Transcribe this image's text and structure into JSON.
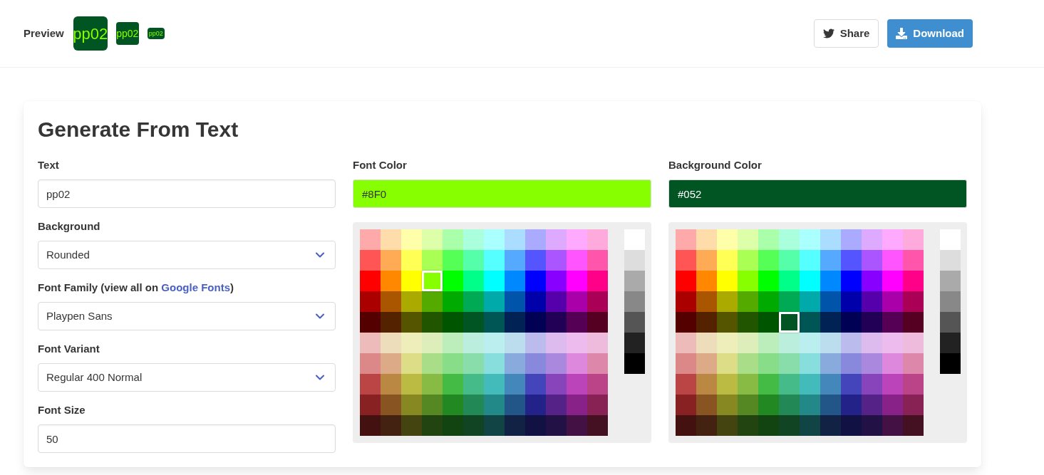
{
  "header": {
    "preview_label": "Preview",
    "previews": [
      {
        "text": "pp02",
        "kind": "large"
      },
      {
        "text": "pp02",
        "kind": "medium"
      },
      {
        "text": "pp02",
        "kind": "small"
      }
    ],
    "share": "Share",
    "download": "Download"
  },
  "card": {
    "title": "Generate From Text",
    "fields": [
      {
        "kind": "input",
        "label": "Text",
        "value": "pp02"
      },
      {
        "kind": "select",
        "label": "Background",
        "value": "Rounded"
      },
      {
        "kind": "select",
        "label": "Font Family (view all on ",
        "link": "Google Fonts",
        "label_suffix": ")",
        "value": "Playpen Sans"
      },
      {
        "kind": "select",
        "label": "Font Variant",
        "value": "Regular 400 Normal"
      },
      {
        "kind": "input",
        "label": "Font Size",
        "value": "50"
      }
    ],
    "pickers": [
      {
        "label": "Font Color",
        "value": "#8F0",
        "rows": [
          [
            {
              "color": "#ffaaaa",
              "selected": false
            },
            {
              "color": "#ffddaa",
              "selected": false
            },
            {
              "color": "#ffffaa",
              "selected": false
            },
            {
              "color": "#ddffaa",
              "selected": false
            },
            {
              "color": "#aaffaa",
              "selected": false
            },
            {
              "color": "#aaffdd",
              "selected": false
            },
            {
              "color": "#aaffff",
              "selected": false
            },
            {
              "color": "#aaddff",
              "selected": false
            },
            {
              "color": "#aaaaff",
              "selected": false
            },
            {
              "color": "#ddaaff",
              "selected": false
            },
            {
              "color": "#ffaaff",
              "selected": false
            },
            {
              "color": "#ffaadd",
              "selected": false
            }
          ],
          [
            {
              "color": "#ff5555",
              "selected": false
            },
            {
              "color": "#ffaa55",
              "selected": false
            },
            {
              "color": "#ffff55",
              "selected": false
            },
            {
              "color": "#aaff55",
              "selected": false
            },
            {
              "color": "#55ff55",
              "selected": false
            },
            {
              "color": "#55ffaa",
              "selected": false
            },
            {
              "color": "#55ffff",
              "selected": false
            },
            {
              "color": "#55aaff",
              "selected": false
            },
            {
              "color": "#5555ff",
              "selected": false
            },
            {
              "color": "#aa55ff",
              "selected": false
            },
            {
              "color": "#ff55ff",
              "selected": false
            },
            {
              "color": "#ff55aa",
              "selected": false
            }
          ],
          [
            {
              "color": "#ff0000",
              "selected": false
            },
            {
              "color": "#ff8800",
              "selected": false
            },
            {
              "color": "#ffff00",
              "selected": false
            },
            {
              "color": "#88ff00",
              "selected": true
            },
            {
              "color": "#00ff00",
              "selected": false
            },
            {
              "color": "#00ff88",
              "selected": false
            },
            {
              "color": "#00ffff",
              "selected": false
            },
            {
              "color": "#0088ff",
              "selected": false
            },
            {
              "color": "#0000ff",
              "selected": false
            },
            {
              "color": "#8800ff",
              "selected": false
            },
            {
              "color": "#ff00ff",
              "selected": false
            },
            {
              "color": "#ff0088",
              "selected": false
            }
          ],
          [
            {
              "color": "#aa0000",
              "selected": false
            },
            {
              "color": "#aa5500",
              "selected": false
            },
            {
              "color": "#aaaa00",
              "selected": false
            },
            {
              "color": "#55aa00",
              "selected": false
            },
            {
              "color": "#00aa00",
              "selected": false
            },
            {
              "color": "#00aa55",
              "selected": false
            },
            {
              "color": "#00aaaa",
              "selected": false
            },
            {
              "color": "#0055aa",
              "selected": false
            },
            {
              "color": "#0000aa",
              "selected": false
            },
            {
              "color": "#5500aa",
              "selected": false
            },
            {
              "color": "#aa00aa",
              "selected": false
            },
            {
              "color": "#aa0055",
              "selected": false
            }
          ],
          [
            {
              "color": "#550000",
              "selected": false
            },
            {
              "color": "#552200",
              "selected": false
            },
            {
              "color": "#555500",
              "selected": false
            },
            {
              "color": "#225500",
              "selected": false
            },
            {
              "color": "#005500",
              "selected": false
            },
            {
              "color": "#005522",
              "selected": false
            },
            {
              "color": "#005555",
              "selected": false
            },
            {
              "color": "#002255",
              "selected": false
            },
            {
              "color": "#000055",
              "selected": false
            },
            {
              "color": "#220055",
              "selected": false
            },
            {
              "color": "#550055",
              "selected": false
            },
            {
              "color": "#550022",
              "selected": false
            }
          ],
          [
            {
              "color": "#eebbbb",
              "selected": false
            },
            {
              "color": "#eeddbb",
              "selected": false
            },
            {
              "color": "#eeeebb",
              "selected": false
            },
            {
              "color": "#ddeebb",
              "selected": false
            },
            {
              "color": "#bbeebb",
              "selected": false
            },
            {
              "color": "#bbeedd",
              "selected": false
            },
            {
              "color": "#bbeeee",
              "selected": false
            },
            {
              "color": "#bbddee",
              "selected": false
            },
            {
              "color": "#bbbbee",
              "selected": false
            },
            {
              "color": "#ddbbee",
              "selected": false
            },
            {
              "color": "#eebbee",
              "selected": false
            },
            {
              "color": "#eebbdd",
              "selected": false
            }
          ],
          [
            {
              "color": "#dd8888",
              "selected": false
            },
            {
              "color": "#ddaa88",
              "selected": false
            },
            {
              "color": "#dddd88",
              "selected": false
            },
            {
              "color": "#aadd88",
              "selected": false
            },
            {
              "color": "#88dd88",
              "selected": false
            },
            {
              "color": "#88ddaa",
              "selected": false
            },
            {
              "color": "#88dddd",
              "selected": false
            },
            {
              "color": "#88aadd",
              "selected": false
            },
            {
              "color": "#8888dd",
              "selected": false
            },
            {
              "color": "#aa88dd",
              "selected": false
            },
            {
              "color": "#dd88dd",
              "selected": false
            },
            {
              "color": "#dd88aa",
              "selected": false
            }
          ],
          [
            {
              "color": "#bb4444",
              "selected": false
            },
            {
              "color": "#bb8844",
              "selected": false
            },
            {
              "color": "#bbbb44",
              "selected": false
            },
            {
              "color": "#88bb44",
              "selected": false
            },
            {
              "color": "#44bb44",
              "selected": false
            },
            {
              "color": "#44bb88",
              "selected": false
            },
            {
              "color": "#44bbbb",
              "selected": false
            },
            {
              "color": "#4488bb",
              "selected": false
            },
            {
              "color": "#4444bb",
              "selected": false
            },
            {
              "color": "#8844bb",
              "selected": false
            },
            {
              "color": "#bb44bb",
              "selected": false
            },
            {
              "color": "#bb4488",
              "selected": false
            }
          ],
          [
            {
              "color": "#882222",
              "selected": false
            },
            {
              "color": "#885522",
              "selected": false
            },
            {
              "color": "#888822",
              "selected": false
            },
            {
              "color": "#558822",
              "selected": false
            },
            {
              "color": "#228822",
              "selected": false
            },
            {
              "color": "#228855",
              "selected": false
            },
            {
              "color": "#228888",
              "selected": false
            },
            {
              "color": "#225588",
              "selected": false
            },
            {
              "color": "#222288",
              "selected": false
            },
            {
              "color": "#552288",
              "selected": false
            },
            {
              "color": "#882288",
              "selected": false
            },
            {
              "color": "#882255",
              "selected": false
            }
          ],
          [
            {
              "color": "#441111",
              "selected": false
            },
            {
              "color": "#442211",
              "selected": false
            },
            {
              "color": "#444411",
              "selected": false
            },
            {
              "color": "#224411",
              "selected": false
            },
            {
              "color": "#114411",
              "selected": false
            },
            {
              "color": "#114422",
              "selected": false
            },
            {
              "color": "#114444",
              "selected": false
            },
            {
              "color": "#112244",
              "selected": false
            },
            {
              "color": "#111144",
              "selected": false
            },
            {
              "color": "#221144",
              "selected": false
            },
            {
              "color": "#441144",
              "selected": false
            },
            {
              "color": "#441122",
              "selected": false
            }
          ]
        ],
        "grays": [
          {
            "color": "#ffffff",
            "selected": false
          },
          {
            "color": "#dddddd",
            "selected": false
          },
          {
            "color": "#aaaaaa",
            "selected": false
          },
          {
            "color": "#888888",
            "selected": false
          },
          {
            "color": "#555555",
            "selected": false
          },
          {
            "color": "#222222",
            "selected": false
          },
          {
            "color": "#000000",
            "selected": false
          }
        ]
      },
      {
        "label": "Background Color",
        "value": "#052",
        "rows": [
          [
            {
              "color": "#ffaaaa",
              "selected": false
            },
            {
              "color": "#ffddaa",
              "selected": false
            },
            {
              "color": "#ffffaa",
              "selected": false
            },
            {
              "color": "#ddffaa",
              "selected": false
            },
            {
              "color": "#aaffaa",
              "selected": false
            },
            {
              "color": "#aaffdd",
              "selected": false
            },
            {
              "color": "#aaffff",
              "selected": false
            },
            {
              "color": "#aaddff",
              "selected": false
            },
            {
              "color": "#aaaaff",
              "selected": false
            },
            {
              "color": "#ddaaff",
              "selected": false
            },
            {
              "color": "#ffaaff",
              "selected": false
            },
            {
              "color": "#ffaadd",
              "selected": false
            }
          ],
          [
            {
              "color": "#ff5555",
              "selected": false
            },
            {
              "color": "#ffaa55",
              "selected": false
            },
            {
              "color": "#ffff55",
              "selected": false
            },
            {
              "color": "#aaff55",
              "selected": false
            },
            {
              "color": "#55ff55",
              "selected": false
            },
            {
              "color": "#55ffaa",
              "selected": false
            },
            {
              "color": "#55ffff",
              "selected": false
            },
            {
              "color": "#55aaff",
              "selected": false
            },
            {
              "color": "#5555ff",
              "selected": false
            },
            {
              "color": "#aa55ff",
              "selected": false
            },
            {
              "color": "#ff55ff",
              "selected": false
            },
            {
              "color": "#ff55aa",
              "selected": false
            }
          ],
          [
            {
              "color": "#ff0000",
              "selected": false
            },
            {
              "color": "#ff8800",
              "selected": false
            },
            {
              "color": "#ffff00",
              "selected": false
            },
            {
              "color": "#88ff00",
              "selected": false
            },
            {
              "color": "#00ff00",
              "selected": false
            },
            {
              "color": "#00ff88",
              "selected": false
            },
            {
              "color": "#00ffff",
              "selected": false
            },
            {
              "color": "#0088ff",
              "selected": false
            },
            {
              "color": "#0000ff",
              "selected": false
            },
            {
              "color": "#8800ff",
              "selected": false
            },
            {
              "color": "#ff00ff",
              "selected": false
            },
            {
              "color": "#ff0088",
              "selected": false
            }
          ],
          [
            {
              "color": "#aa0000",
              "selected": false
            },
            {
              "color": "#aa5500",
              "selected": false
            },
            {
              "color": "#aaaa00",
              "selected": false
            },
            {
              "color": "#55aa00",
              "selected": false
            },
            {
              "color": "#00aa00",
              "selected": false
            },
            {
              "color": "#00aa55",
              "selected": false
            },
            {
              "color": "#00aaaa",
              "selected": false
            },
            {
              "color": "#0055aa",
              "selected": false
            },
            {
              "color": "#0000aa",
              "selected": false
            },
            {
              "color": "#5500aa",
              "selected": false
            },
            {
              "color": "#aa00aa",
              "selected": false
            },
            {
              "color": "#aa0055",
              "selected": false
            }
          ],
          [
            {
              "color": "#550000",
              "selected": false
            },
            {
              "color": "#552200",
              "selected": false
            },
            {
              "color": "#555500",
              "selected": false
            },
            {
              "color": "#225500",
              "selected": false
            },
            {
              "color": "#005500",
              "selected": false
            },
            {
              "color": "#005522",
              "selected": true
            },
            {
              "color": "#005555",
              "selected": false
            },
            {
              "color": "#002255",
              "selected": false
            },
            {
              "color": "#000055",
              "selected": false
            },
            {
              "color": "#220055",
              "selected": false
            },
            {
              "color": "#550055",
              "selected": false
            },
            {
              "color": "#550022",
              "selected": false
            }
          ],
          [
            {
              "color": "#eebbbb",
              "selected": false
            },
            {
              "color": "#eeddbb",
              "selected": false
            },
            {
              "color": "#eeeebb",
              "selected": false
            },
            {
              "color": "#ddeebb",
              "selected": false
            },
            {
              "color": "#bbeebb",
              "selected": false
            },
            {
              "color": "#bbeedd",
              "selected": false
            },
            {
              "color": "#bbeeee",
              "selected": false
            },
            {
              "color": "#bbddee",
              "selected": false
            },
            {
              "color": "#bbbbee",
              "selected": false
            },
            {
              "color": "#ddbbee",
              "selected": false
            },
            {
              "color": "#eebbee",
              "selected": false
            },
            {
              "color": "#eebbdd",
              "selected": false
            }
          ],
          [
            {
              "color": "#dd8888",
              "selected": false
            },
            {
              "color": "#ddaa88",
              "selected": false
            },
            {
              "color": "#dddd88",
              "selected": false
            },
            {
              "color": "#aadd88",
              "selected": false
            },
            {
              "color": "#88dd88",
              "selected": false
            },
            {
              "color": "#88ddaa",
              "selected": false
            },
            {
              "color": "#88dddd",
              "selected": false
            },
            {
              "color": "#88aadd",
              "selected": false
            },
            {
              "color": "#8888dd",
              "selected": false
            },
            {
              "color": "#aa88dd",
              "selected": false
            },
            {
              "color": "#dd88dd",
              "selected": false
            },
            {
              "color": "#dd88aa",
              "selected": false
            }
          ],
          [
            {
              "color": "#bb4444",
              "selected": false
            },
            {
              "color": "#bb8844",
              "selected": false
            },
            {
              "color": "#bbbb44",
              "selected": false
            },
            {
              "color": "#88bb44",
              "selected": false
            },
            {
              "color": "#44bb44",
              "selected": false
            },
            {
              "color": "#44bb88",
              "selected": false
            },
            {
              "color": "#44bbbb",
              "selected": false
            },
            {
              "color": "#4488bb",
              "selected": false
            },
            {
              "color": "#4444bb",
              "selected": false
            },
            {
              "color": "#8844bb",
              "selected": false
            },
            {
              "color": "#bb44bb",
              "selected": false
            },
            {
              "color": "#bb4488",
              "selected": false
            }
          ],
          [
            {
              "color": "#882222",
              "selected": false
            },
            {
              "color": "#885522",
              "selected": false
            },
            {
              "color": "#888822",
              "selected": false
            },
            {
              "color": "#558822",
              "selected": false
            },
            {
              "color": "#228822",
              "selected": false
            },
            {
              "color": "#228855",
              "selected": false
            },
            {
              "color": "#228888",
              "selected": false
            },
            {
              "color": "#225588",
              "selected": false
            },
            {
              "color": "#222288",
              "selected": false
            },
            {
              "color": "#552288",
              "selected": false
            },
            {
              "color": "#882288",
              "selected": false
            },
            {
              "color": "#882255",
              "selected": false
            }
          ],
          [
            {
              "color": "#441111",
              "selected": false
            },
            {
              "color": "#442211",
              "selected": false
            },
            {
              "color": "#444411",
              "selected": false
            },
            {
              "color": "#224411",
              "selected": false
            },
            {
              "color": "#114411",
              "selected": false
            },
            {
              "color": "#114422",
              "selected": false
            },
            {
              "color": "#114444",
              "selected": false
            },
            {
              "color": "#112244",
              "selected": false
            },
            {
              "color": "#111144",
              "selected": false
            },
            {
              "color": "#221144",
              "selected": false
            },
            {
              "color": "#441144",
              "selected": false
            },
            {
              "color": "#441122",
              "selected": false
            }
          ]
        ],
        "grays": [
          {
            "color": "#ffffff",
            "selected": false
          },
          {
            "color": "#dddddd",
            "selected": false
          },
          {
            "color": "#aaaaaa",
            "selected": false
          },
          {
            "color": "#888888",
            "selected": false
          },
          {
            "color": "#555555",
            "selected": false
          },
          {
            "color": "#222222",
            "selected": false
          },
          {
            "color": "#000000",
            "selected": false
          }
        ]
      }
    ]
  }
}
